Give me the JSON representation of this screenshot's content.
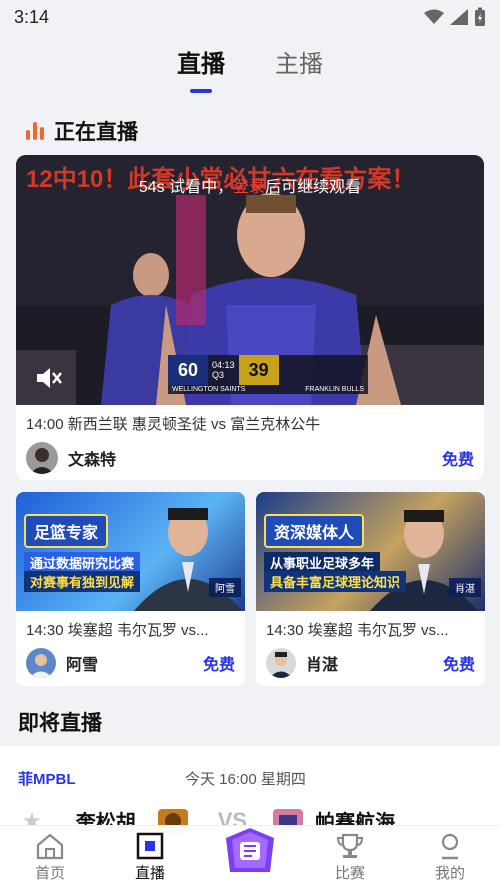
{
  "status": {
    "time": "3:14"
  },
  "tabs": [
    {
      "label": "直播",
      "active": true
    },
    {
      "label": "主播",
      "active": false
    }
  ],
  "live_section": {
    "title": "正在直播"
  },
  "featured": {
    "scroll_text": "12中10！此套小常必甘六在看方案！",
    "preview_tip_prefix": "54s 试看中，",
    "preview_tip_login": "登录",
    "preview_tip_suffix": "后可继续观看",
    "scoreboard": {
      "home_team": "WELLINGTON SAINTS",
      "home_score": "60",
      "clock": "04:13",
      "quarter": "Q3",
      "away_score": "39",
      "away_team": "FRANKLIN BULLS"
    },
    "title": "14:00 新西兰联 惠灵顿圣徒 vs 富兰克林公牛",
    "anchor": "文森特",
    "price": "免费"
  },
  "cards": [
    {
      "badge": "足篮专家",
      "slogan1": "通过数据研究比赛",
      "slogan2": "对赛事有独到见解",
      "nametag": "阿雪",
      "title": "14:30 埃塞超 韦尔瓦罗 vs...",
      "anchor": "阿雪",
      "price": "免费"
    },
    {
      "badge": "资深媒体人",
      "slogan1": "从事职业足球多年",
      "slogan2": "具备丰富足球理论知识",
      "nametag": "肖湛",
      "title": "14:30 埃塞超 韦尔瓦罗 vs...",
      "anchor": "肖湛",
      "price": "免费"
    }
  ],
  "upcoming": {
    "title": "即将直播",
    "league": "菲MPBL",
    "time": "今天 16:00 星期四",
    "home_team": "奎松胡",
    "vs": "VS",
    "away_team": "帕赛航海"
  },
  "nav": [
    {
      "label": "首页",
      "icon": "home-icon"
    },
    {
      "label": "直播",
      "icon": "live-icon",
      "active": true
    },
    {
      "label": "",
      "icon": "promo-icon"
    },
    {
      "label": "比赛",
      "icon": "trophy-icon"
    },
    {
      "label": "我的",
      "icon": "profile-icon"
    }
  ],
  "colors": {
    "accent": "#2a35e6",
    "flame": "#f3672b",
    "login": "#ff3b30"
  }
}
